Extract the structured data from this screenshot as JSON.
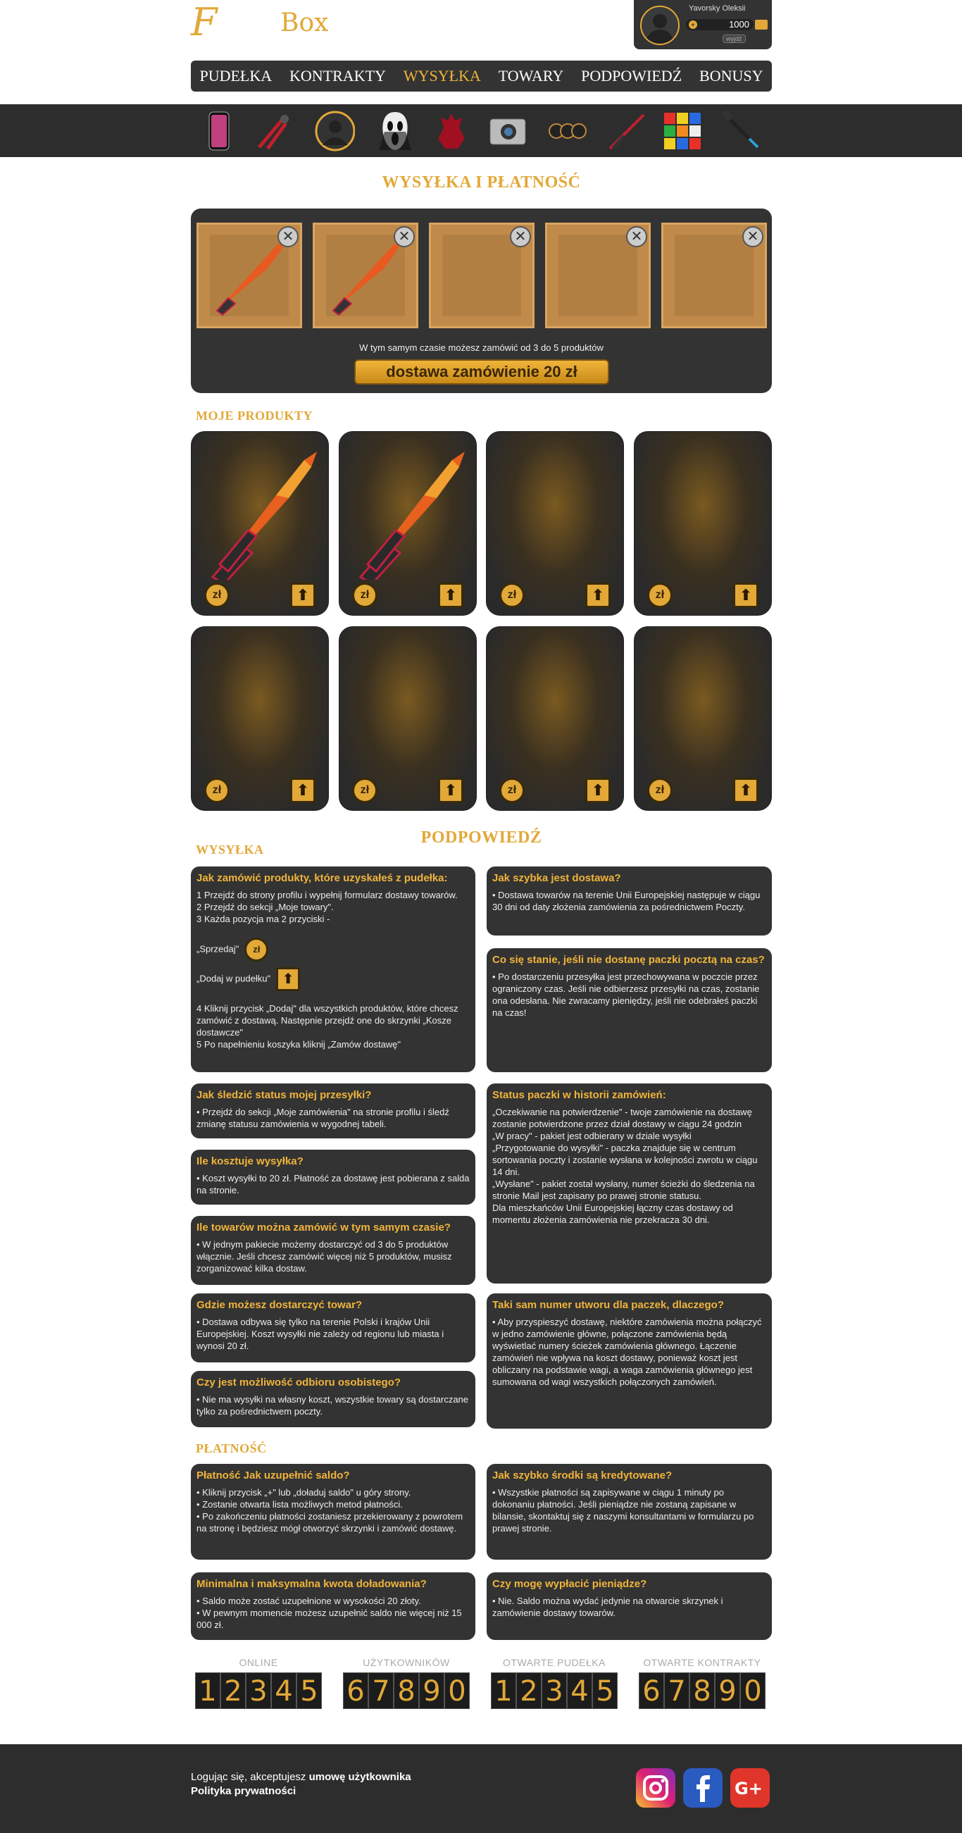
{
  "brand": {
    "letter": "F",
    "name": "Box"
  },
  "user": {
    "name": "Yavorsky Oleksii",
    "balance": "1000",
    "logout": "wyjdź"
  },
  "nav": [
    {
      "label": "PUDEŁKA"
    },
    {
      "label": "KONTRAKTY"
    },
    {
      "label": "WYSYŁKA"
    },
    {
      "label": "TOWARY"
    },
    {
      "label": "PODPOWIEDŹ"
    },
    {
      "label": "BONUSY"
    }
  ],
  "strip_icons": [
    "phone-icon",
    "bolt-cutter-icon",
    "avatar-icon",
    "scream-mask-icon",
    "demon-figure-icon",
    "action-camera-icon",
    "fidget-spinner-icon",
    "red-knife-icon",
    "rubik-cube-icon",
    "selfie-stick-icon"
  ],
  "shipping": {
    "title": "WYSYŁKA I PŁATNOŚĆ",
    "note": "W tym samym czasie możesz zamówić od 3 do 5 produktów",
    "order_button": "dostawa zamówienie 20 zł",
    "remove_label": "✕"
  },
  "products": {
    "title": "MOJE PRODUKTY",
    "sell_label": "zł",
    "add_label": "⬆"
  },
  "help_title": "PODPOWIEDŹ",
  "shipping_section_title": "WYSYŁKA",
  "payment_section_title": "PŁATNOŚĆ",
  "faq": {
    "q1": {
      "title": "Jak zamówić produkty, które uzyskałeś z pudełka:",
      "l1": "1 Przejdź do strony profilu i wypełnij formularz dostawy towarów.",
      "l2": "2 Przejdź do sekcji „Moje towary\".",
      "l3": "3 Każda pozycja ma 2 przyciski -",
      "sell": "„Sprzedaj\"",
      "add": "„Dodaj w pudełku\"",
      "l4": "4 Kliknij przycisk „Dodaj\" dla wszystkich produktów, które chcesz zamówić z dostawą. Następnie przejdź one do skrzynki „Kosze dostawcze\"",
      "l5": "5 Po napełnieniu koszyka kliknij „Zamów dostawę\""
    },
    "q2": {
      "title": "Jak szybka jest dostawa?",
      "text": "• Dostawa towarów na terenie Unii Europejskiej następuje w ciągu 30 dni od daty złożenia zamówienia za pośrednictwem Poczty."
    },
    "q3": {
      "title": "Co się stanie, jeśli nie dostanę paczki pocztą na czas?",
      "text": "• Po dostarczeniu przesyłka jest przechowywana w poczcie przez ograniczony czas. Jeśli nie odbierzesz przesyłki na czas, zostanie ona odesłana. Nie zwracamy pieniędzy, jeśli nie odebrałeś paczki na czas!"
    },
    "q4": {
      "title": "Jak śledzić status mojej przesyłki?",
      "text": "• Przejdź do sekcji „Moje zamówienia\" na stronie profilu i śledź zmianę statusu zamówienia w wygodnej tabeli."
    },
    "q5": {
      "title": "Status paczki w historii zamówień:",
      "l1": "„Oczekiwanie na potwierdzenie\" - twoje zamówienie na dostawę zostanie potwierdzone przez dział dostawy w ciągu 24 godzin",
      "l2": "„W pracy\" - pakiet jest odbierany w dziale wysyłki",
      "l3": "„Przygotowanie do wysyłki\" - paczka znajduje się w centrum sortowania poczty i zostanie wysłana w kolejności zwrotu w ciągu 14 dni.",
      "l4": "„Wysłane\" - pakiet został wysłany, numer ścieżki do śledzenia na stronie Mail jest zapisany po prawej stronie statusu.",
      "l5": "Dla mieszkańców Unii Europejskiej łączny czas dostawy od momentu złożenia zamówienia nie przekracza 30 dni."
    },
    "q6": {
      "title": "Ile kosztuje wysyłka?",
      "text": "• Koszt wysyłki to 20 zł. Płatność za dostawę jest pobierana z salda na stronie."
    },
    "q7": {
      "title": "Ile towarów można zamówić w tym samym czasie?",
      "text": "• W jednym pakiecie możemy dostarczyć od 3 do 5 produktów włącznie. Jeśli chcesz zamówić więcej niż 5 produktów, musisz zorganizować kilka dostaw."
    },
    "q8": {
      "title": "Gdzie możesz dostarczyć towar?",
      "text": "• Dostawa odbywa się tylko na terenie Polski i krajów Unii Europejskiej. Koszt wysyłki nie zależy od regionu lub miasta i wynosi 20 zł."
    },
    "q9": {
      "title": "Taki sam numer utworu dla paczek, dlaczego?",
      "text": "• Aby przyspieszyć dostawę, niektóre zamówienia można połączyć w jedno zamówienie główne, połączone zamówienia będą wyświetlać numery ścieżek zamówienia głównego. Łączenie zamówień nie wpływa na koszt dostawy, ponieważ koszt jest obliczany na podstawie wagi, a waga zamówienia głównego jest sumowana od wagi wszystkich połączonych zamówień."
    },
    "q10": {
      "title": "Czy jest możliwość odbioru osobistego?",
      "text": "• Nie ma wysyłki na własny koszt, wszystkie towary są dostarczane tylko za pośrednictwem poczty."
    },
    "p1": {
      "title": "Płatność Jak uzupełnić saldo?",
      "l1": "• Kliknij przycisk „+\" lub „doładuj saldo\" u góry strony.",
      "l2": "• Zostanie otwarta lista możliwych metod płatności.",
      "l3": "• Po zakończeniu płatności zostaniesz przekierowany z powrotem na stronę i będziesz mógł otworzyć skrzynki i zamówić dostawę."
    },
    "p2": {
      "title": "Jak szybko środki są kredytowane?",
      "text": "• Wszystkie płatności są zapisywane w ciągu 1 minuty po dokonaniu płatności. Jeśli pieniądze nie zostaną zapisane w bilansie, skontaktuj się z naszymi konsultantami w formularzu po prawej stronie."
    },
    "p3": {
      "title": "Minimalna i maksymalna kwota doładowania?",
      "l1": "• Saldo może zostać uzupełnione w wysokości 20 złoty.",
      "l2": "• W pewnym momencie możesz uzupełnić saldo nie więcej niż 15 000 zł."
    },
    "p4": {
      "title": "Czy mogę wypłacić pieniądze?",
      "text": "• Nie. Saldo można wydać jedynie na otwarcie skrzynek i zamówienie dostawy towarów."
    }
  },
  "counters": [
    {
      "label": "ONLINE",
      "digits": [
        "1",
        "2",
        "3",
        "4",
        "5"
      ]
    },
    {
      "label": "UŻYTKOWNIKÓW",
      "digits": [
        "6",
        "7",
        "8",
        "9",
        "0"
      ]
    },
    {
      "label": "OTWARTE PUDEŁKA",
      "digits": [
        "1",
        "2",
        "3",
        "4",
        "5"
      ]
    },
    {
      "label": "OTWARTE KONTRAKTY",
      "digits": [
        "6",
        "7",
        "8",
        "9",
        "0"
      ]
    }
  ],
  "footer": {
    "prefix": "Logując się, akceptujesz ",
    "terms": "umowę użytkownika",
    "privacy": "Polityka prywatności"
  },
  "colors": {
    "accent": "#e2a838",
    "panel": "#333333",
    "strip": "#2d2d2d"
  }
}
